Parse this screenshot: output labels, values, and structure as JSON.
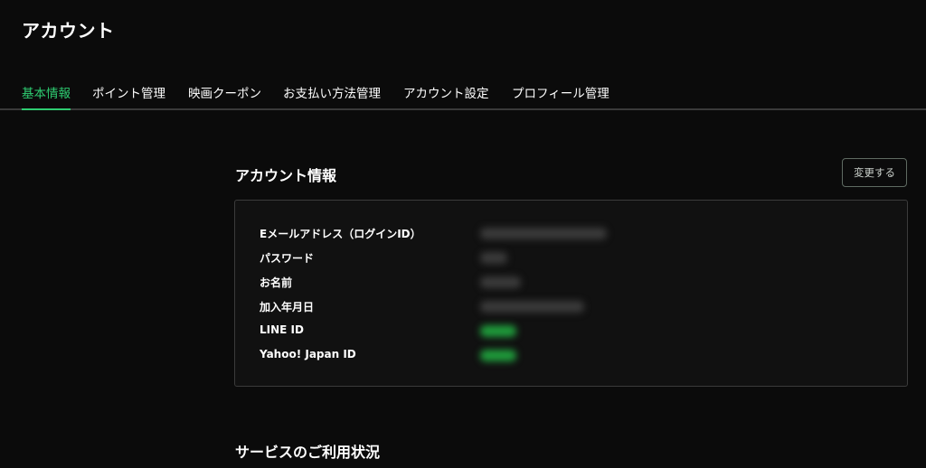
{
  "header": {
    "title": "アカウント"
  },
  "tabs": [
    {
      "label": "基本情報",
      "active": true
    },
    {
      "label": "ポイント管理",
      "active": false
    },
    {
      "label": "映画クーポン",
      "active": false
    },
    {
      "label": "お支払い方法管理",
      "active": false
    },
    {
      "label": "アカウント設定",
      "active": false
    },
    {
      "label": "プロフィール管理",
      "active": false
    }
  ],
  "account_info": {
    "title": "アカウント情報",
    "edit_label": "変更する",
    "rows": [
      {
        "label": "Eメールアドレス（ログインID）",
        "value_state": "blurred"
      },
      {
        "label": "パスワード",
        "value_state": "blurred"
      },
      {
        "label": "お名前",
        "value_state": "blurred"
      },
      {
        "label": "加入年月日",
        "value_state": "blurred"
      },
      {
        "label": "LINE ID",
        "value_state": "blurred-green"
      },
      {
        "label": "Yahoo! Japan ID",
        "value_state": "blurred-green"
      }
    ]
  },
  "services": {
    "title": "サービスのご利用状況"
  },
  "colors": {
    "accent": "#2ecc71",
    "background": "#0b0b0b",
    "card_border": "#3b3b3b"
  }
}
